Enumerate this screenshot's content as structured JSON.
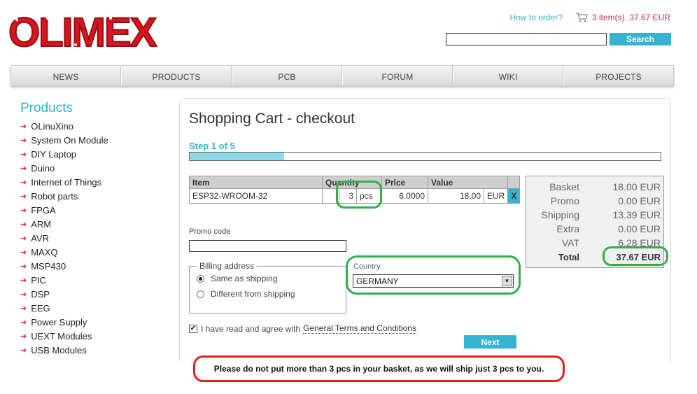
{
  "header": {
    "logo_text": "OLIMEX",
    "how_to_order": "How to order?",
    "cart_summary": "3 item(s). 37.67 EUR",
    "search_placeholder": "",
    "search_button": "Search"
  },
  "nav": [
    "NEWS",
    "PRODUCTS",
    "PCB",
    "FORUM",
    "WIKI",
    "PROJECTS"
  ],
  "sidebar": {
    "title": "Products",
    "items": [
      "OLinuXino",
      "System On Module",
      "DIY Laptop",
      "Duino",
      "Internet of Things",
      "Robot parts",
      "FPGA",
      "ARM",
      "AVR",
      "MAXQ",
      "MSP430",
      "PIC",
      "DSP",
      "EEG",
      "Power Supply",
      "UEXT Modules",
      "USB Modules"
    ]
  },
  "checkout": {
    "title": "Shopping Cart - checkout",
    "step": "Step 1 of 5",
    "progress_fraction": 0.2,
    "table": {
      "headers": [
        "Item",
        "Quantity",
        "Price",
        "Value"
      ],
      "row": {
        "item": "ESP32-WROOM-32",
        "qty": "3",
        "unit": "pcs",
        "price": "6.0000",
        "value": "18.00",
        "currency": "EUR",
        "remove": "X"
      }
    },
    "summary": [
      {
        "label": "Basket",
        "value": "18.00 EUR"
      },
      {
        "label": "Promo",
        "value": "0.00 EUR"
      },
      {
        "label": "Shipping",
        "value": "13.39 EUR"
      },
      {
        "label": "Extra",
        "value": "0.00 EUR"
      },
      {
        "label": "VAT",
        "value": "6.28 EUR"
      },
      {
        "label": "Total",
        "value": "37.67 EUR"
      }
    ],
    "promo_label": "Promo code",
    "promo_value": "",
    "billing": {
      "legend": "Billing address",
      "same": "Same as shipping",
      "different": "Different from shipping"
    },
    "country_label": "Country",
    "country_value": "GERMANY",
    "terms_prefix": "I have read and agree with",
    "terms_link": "General Terms and Conditions",
    "next": "Next"
  },
  "notice": "Please do not put more than 3 pcs in your basket, as we will ship just 3 pcs to you.",
  "colors": {
    "accent": "#2fb5c6",
    "button": "#36b3d3",
    "brand_red": "#d2245e",
    "highlight_green": "#2fb04a",
    "notice_red": "#e02020"
  }
}
